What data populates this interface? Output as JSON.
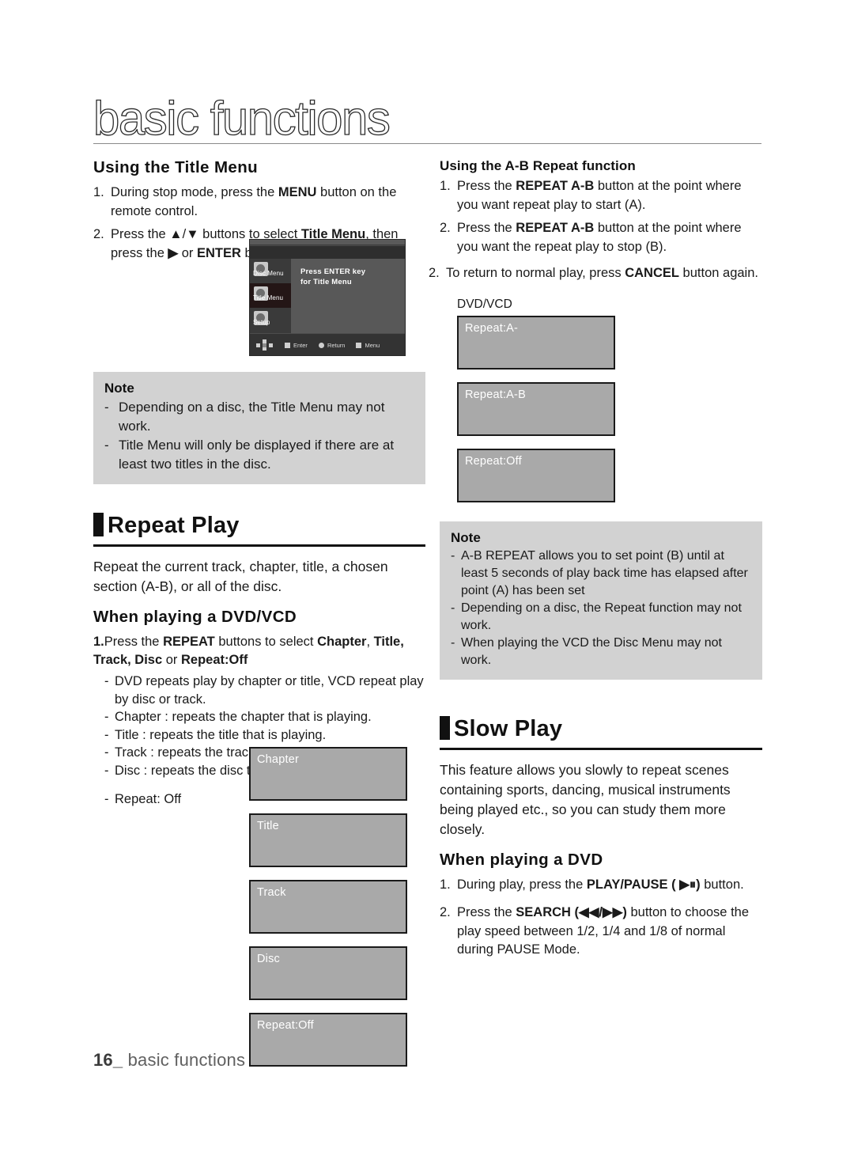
{
  "header": {
    "title": "basic functions"
  },
  "left": {
    "title_menu": {
      "heading": "Using the Title Menu",
      "steps": [
        {
          "num": "1.",
          "html": "During stop mode, press the <b>MENU</b> button on the remote control."
        },
        {
          "num": "2.",
          "html": "Press the <b>▲</b>/<b>▼</b> buttons to select <b>Title Menu</b>, then press the <b>▶</b> or <b>ENTER</b> button."
        }
      ]
    },
    "tv_screen": {
      "title_bar": "",
      "menu_items": [
        {
          "label": "Disc Menu",
          "icon": "disc-menu-icon",
          "selected": false
        },
        {
          "label": "Title Menu",
          "icon": "title-menu-icon",
          "selected": true
        },
        {
          "label": "Setup",
          "icon": "setup-icon",
          "selected": false
        }
      ],
      "main_text_line1": "Press ENTER key",
      "main_text_line2": "for Title Menu",
      "hints": [
        {
          "label": "Enter",
          "icon": "square-bullet"
        },
        {
          "label": "Return",
          "icon": "round-bullet"
        },
        {
          "label": "Menu",
          "icon": "square-bullet"
        }
      ]
    },
    "note": {
      "title": "Note",
      "items": [
        "Depending on a disc, the Title Menu may not work.",
        "Title Menu will only be displayed if there are at least two titles in the disc."
      ]
    },
    "repeat_play": {
      "heading": "Repeat Play",
      "intro": "Repeat the current track, chapter, title, a chosen section (A-B), or all of the disc.",
      "sub_heading": "When playing a DVD/VCD",
      "step1_html": "<b>1.</b>Press the <b>REPEAT</b> buttons to select <b>Chapter</b>, <b>Title, Track, Disc</b> or <b>Repeat:Off</b>",
      "bullets": [
        "DVD repeats play by chapter or title, VCD repeat play by disc or track.",
        "Chapter : repeats the chapter that is playing.",
        "Title : repeats the title that is playing.",
        "Track : repeats the track that is playing.",
        "Disc : repeats the disc that is playing.",
        "Repeat: Off"
      ],
      "osd_boxes": [
        {
          "text": "Chapter"
        },
        {
          "text": "Title"
        },
        {
          "text": "Track"
        },
        {
          "text": "Disc"
        },
        {
          "text": "Repeat:Off"
        }
      ]
    }
  },
  "right": {
    "ab_repeat": {
      "heading": "Using the A-B Repeat function",
      "steps": [
        {
          "num": "1.",
          "html": "Press the <b>REPEAT A-B</b> button at the point where you want repeat play to start (A)."
        },
        {
          "num": "2.",
          "html": "Press the <b>REPEAT A-B</b> button at the point where you want the repeat play to stop (B)."
        }
      ],
      "final_step": {
        "num": "2.",
        "html": "To return to normal play, press <b>CANCEL</b> button again."
      },
      "osd_label": "DVD/VCD",
      "osd_boxes": [
        {
          "text": "Repeat:A-"
        },
        {
          "text": "Repeat:A-B"
        },
        {
          "text": "Repeat:Off"
        }
      ]
    },
    "note": {
      "title": "Note",
      "items": [
        "A-B REPEAT allows you to set point (B) until at least 5 seconds of play back time has elapsed after point (A) has been set",
        "Depending on a disc, the Repeat function may not work.",
        "When playing the VCD the Disc Menu may not work."
      ]
    },
    "slow_play": {
      "heading": "Slow Play",
      "intro": "This feature allows you slowly to repeat scenes containing sports, dancing, musical instruments being played etc., so you can study them more closely.",
      "sub_heading": "When playing a DVD",
      "steps": [
        {
          "num": "1.",
          "html": "During play, press the <b>PLAY/PAUSE (&nbsp;▶⏸)</b> button."
        },
        {
          "num": "2.",
          "html": "Press the <b>SEARCH (◀◀/▶▶)</b> button to choose the play speed between 1/2, 1/4 and 1/8 of normal during PAUSE Mode."
        }
      ]
    }
  },
  "footer": {
    "page_number": "16",
    "underscore": "_",
    "section": "basic functions"
  },
  "colors": {
    "note_bg": "#d2d2d2",
    "osd_bg": "#a9a9a9",
    "osd_border": "#1a1a1a",
    "text": "#1a1a1a",
    "footer_text": "#606060"
  }
}
